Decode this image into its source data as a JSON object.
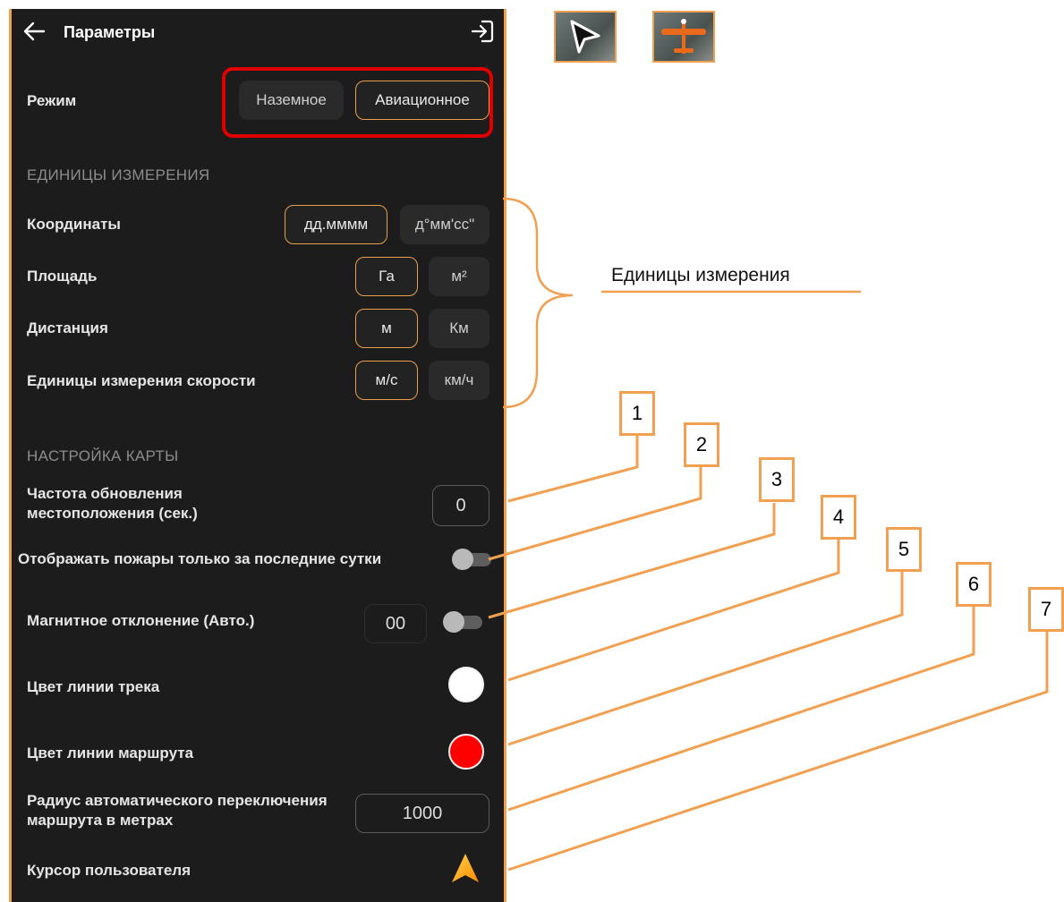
{
  "header": {
    "title": "Параметры",
    "back_icon": "arrow-left-icon",
    "exit_icon": "login-icon"
  },
  "mode": {
    "label": "Режим",
    "options": [
      "Наземное",
      "Авиационное"
    ],
    "selected": "Авиационное"
  },
  "units_section": {
    "title": "ЕДИНИЦЫ ИЗМЕРЕНИЯ",
    "rows": [
      {
        "label": "Координаты",
        "options": [
          "дд.мммм",
          "д°мм'сс\""
        ],
        "selected": "дд.мммм"
      },
      {
        "label": "Площадь",
        "options": [
          "Га",
          "м²"
        ],
        "selected": "Га"
      },
      {
        "label": "Дистанция",
        "options": [
          "м",
          "Км"
        ],
        "selected": "м"
      },
      {
        "label": "Единицы измерения скорости",
        "options": [
          "м/с",
          "км/ч"
        ],
        "selected": "м/с"
      }
    ]
  },
  "map_section": {
    "title": "НАСТРОЙКА КАРТЫ",
    "refresh_label": "Частота обновления местоположения (сек.)",
    "refresh_value": "0",
    "fires_label": "Отображать пожары только за последние сутки",
    "fires_toggle": false,
    "magnetic_label": "Магнитное отклонение (Авто.)",
    "magnetic_value": "00",
    "magnetic_toggle": false,
    "track_color_label": "Цвет линии трека",
    "track_color": "#ffffff",
    "route_color_label": "Цвет линии маршрута",
    "route_color": "#ff0000",
    "radius_label": "Радиус автоматического переключения маршрута в метрах",
    "radius_value": "1000",
    "cursor_label": "Курсор пользователя",
    "cursor_icon": "navigation-arrow-icon"
  },
  "annotations": {
    "units_brace_label": "Единицы измерения",
    "callouts": [
      "1",
      "2",
      "3",
      "4",
      "5",
      "6",
      "7"
    ],
    "accent_color": "#f0a050",
    "highlight_color": "#e00000"
  },
  "thumbnails": [
    {
      "icon": "cursor-arrow-icon"
    },
    {
      "icon": "airplane-icon"
    }
  ]
}
